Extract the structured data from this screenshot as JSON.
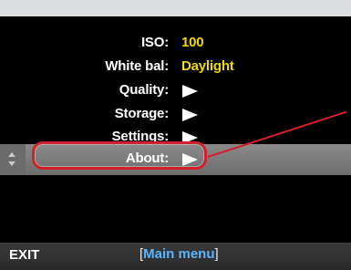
{
  "menu": {
    "iso": {
      "label": "ISO:",
      "value": "100"
    },
    "white_balance": {
      "label": "White bal:",
      "value": "Daylight"
    },
    "quality": {
      "label": "Quality:"
    },
    "storage": {
      "label": "Storage:"
    },
    "settings": {
      "label": "Settings:"
    },
    "about": {
      "label": "About:"
    }
  },
  "bottom_bar": {
    "exit_label": "EXIT",
    "main_menu_label": "Main menu",
    "bracket_open": "[",
    "bracket_close": "]"
  },
  "colors": {
    "value": "#f2d700",
    "label": "#ffffff",
    "highlight": "#6d6d6d",
    "callout": "#d51f2b",
    "main_menu": "#58b6ff"
  }
}
